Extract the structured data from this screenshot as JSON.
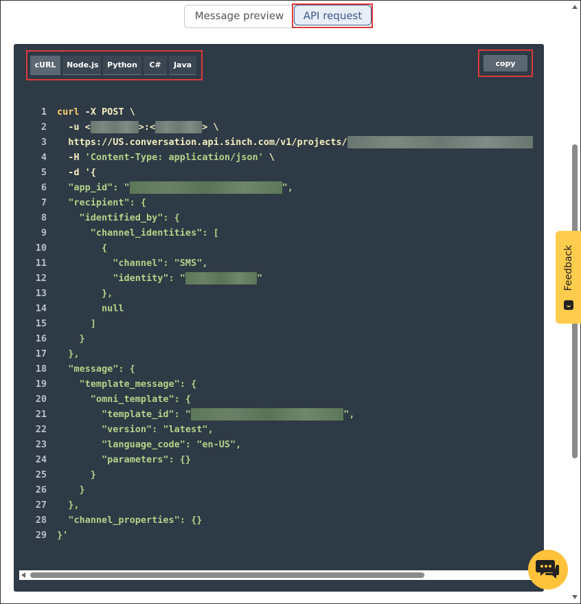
{
  "view_toggle": {
    "preview_label": "Message preview",
    "api_label": "API request"
  },
  "code_tabs": [
    "cURL",
    "Node.js",
    "Python",
    "C#",
    "Java"
  ],
  "copy_label": "copy",
  "code_lines": [
    {
      "n": "1",
      "parts": [
        {
          "t": "curl",
          "c": "kw"
        },
        {
          "t": " -X POST \\",
          "c": "pl"
        }
      ]
    },
    {
      "n": "2",
      "parts": [
        {
          "t": "  -u <",
          "c": "pl"
        },
        {
          "r": 70
        },
        {
          "t": ">:<",
          "c": "pl"
        },
        {
          "r": 68
        },
        {
          "t": "> \\",
          "c": "pl"
        }
      ]
    },
    {
      "n": "3",
      "parts": [
        {
          "t": "  https://US.conversation.api.sinch.com/v1/projects/",
          "c": "pl"
        },
        {
          "r": 270
        }
      ]
    },
    {
      "n": "4",
      "parts": [
        {
          "t": "  -H ",
          "c": "pl"
        },
        {
          "t": "'Content-Type: application/json'",
          "c": "str"
        },
        {
          "t": " \\",
          "c": "pl"
        }
      ]
    },
    {
      "n": "5",
      "parts": [
        {
          "t": "  -d '{",
          "c": "pl"
        }
      ]
    },
    {
      "n": "6",
      "parts": [
        {
          "t": "  \"app_id\": \"",
          "c": "key"
        },
        {
          "r": 222,
          "g": true
        },
        {
          "t": "\",",
          "c": "key"
        }
      ]
    },
    {
      "n": "7",
      "parts": [
        {
          "t": "  \"recipient\": {",
          "c": "key"
        }
      ]
    },
    {
      "n": "8",
      "parts": [
        {
          "t": "    \"identified_by\": {",
          "c": "key"
        }
      ]
    },
    {
      "n": "9",
      "parts": [
        {
          "t": "      \"channel_identities\": [",
          "c": "key"
        }
      ]
    },
    {
      "n": "10",
      "parts": [
        {
          "t": "        {",
          "c": "key"
        }
      ]
    },
    {
      "n": "11",
      "parts": [
        {
          "t": "          \"channel\": \"SMS\",",
          "c": "key"
        }
      ]
    },
    {
      "n": "12",
      "parts": [
        {
          "t": "          \"identity\": \"",
          "c": "key"
        },
        {
          "r": 104,
          "g": true
        },
        {
          "t": "\"",
          "c": "key"
        }
      ]
    },
    {
      "n": "13",
      "parts": [
        {
          "t": "        },",
          "c": "key"
        }
      ]
    },
    {
      "n": "14",
      "parts": [
        {
          "t": "        null",
          "c": "key"
        }
      ]
    },
    {
      "n": "15",
      "parts": [
        {
          "t": "      ]",
          "c": "key"
        }
      ]
    },
    {
      "n": "16",
      "parts": [
        {
          "t": "    }",
          "c": "key"
        }
      ]
    },
    {
      "n": "17",
      "parts": [
        {
          "t": "  },",
          "c": "key"
        }
      ]
    },
    {
      "n": "18",
      "parts": [
        {
          "t": "  \"message\": {",
          "c": "key"
        }
      ]
    },
    {
      "n": "19",
      "parts": [
        {
          "t": "    \"template_message\": {",
          "c": "key"
        }
      ]
    },
    {
      "n": "20",
      "parts": [
        {
          "t": "      \"omni_template\": {",
          "c": "key"
        }
      ]
    },
    {
      "n": "21",
      "parts": [
        {
          "t": "        \"template_id\": \"",
          "c": "key"
        },
        {
          "r": 222,
          "g": true
        },
        {
          "t": "\",",
          "c": "key"
        }
      ]
    },
    {
      "n": "22",
      "parts": [
        {
          "t": "        \"version\": \"latest\",",
          "c": "key"
        }
      ]
    },
    {
      "n": "23",
      "parts": [
        {
          "t": "        \"language_code\": \"en-US\",",
          "c": "key"
        }
      ]
    },
    {
      "n": "24",
      "parts": [
        {
          "t": "        \"parameters\": {}",
          "c": "key"
        }
      ]
    },
    {
      "n": "25",
      "parts": [
        {
          "t": "      }",
          "c": "key"
        }
      ]
    },
    {
      "n": "26",
      "parts": [
        {
          "t": "    }",
          "c": "key"
        }
      ]
    },
    {
      "n": "27",
      "parts": [
        {
          "t": "  },",
          "c": "key"
        }
      ]
    },
    {
      "n": "28",
      "parts": [
        {
          "t": "  \"channel_properties\": {}",
          "c": "key"
        }
      ]
    },
    {
      "n": "29",
      "parts": [
        {
          "t": "}'",
          "c": "key"
        }
      ]
    }
  ],
  "feedback_label": "Feedback",
  "icons": {
    "feedback": "feedback-face-icon",
    "chat": "chat-bubble-icon"
  },
  "colors": {
    "code_bg": "#2e3a45",
    "highlight": "#e03a3a",
    "feedback_bg": "#ffcc4d",
    "chat_bg": "#ffc23a"
  }
}
